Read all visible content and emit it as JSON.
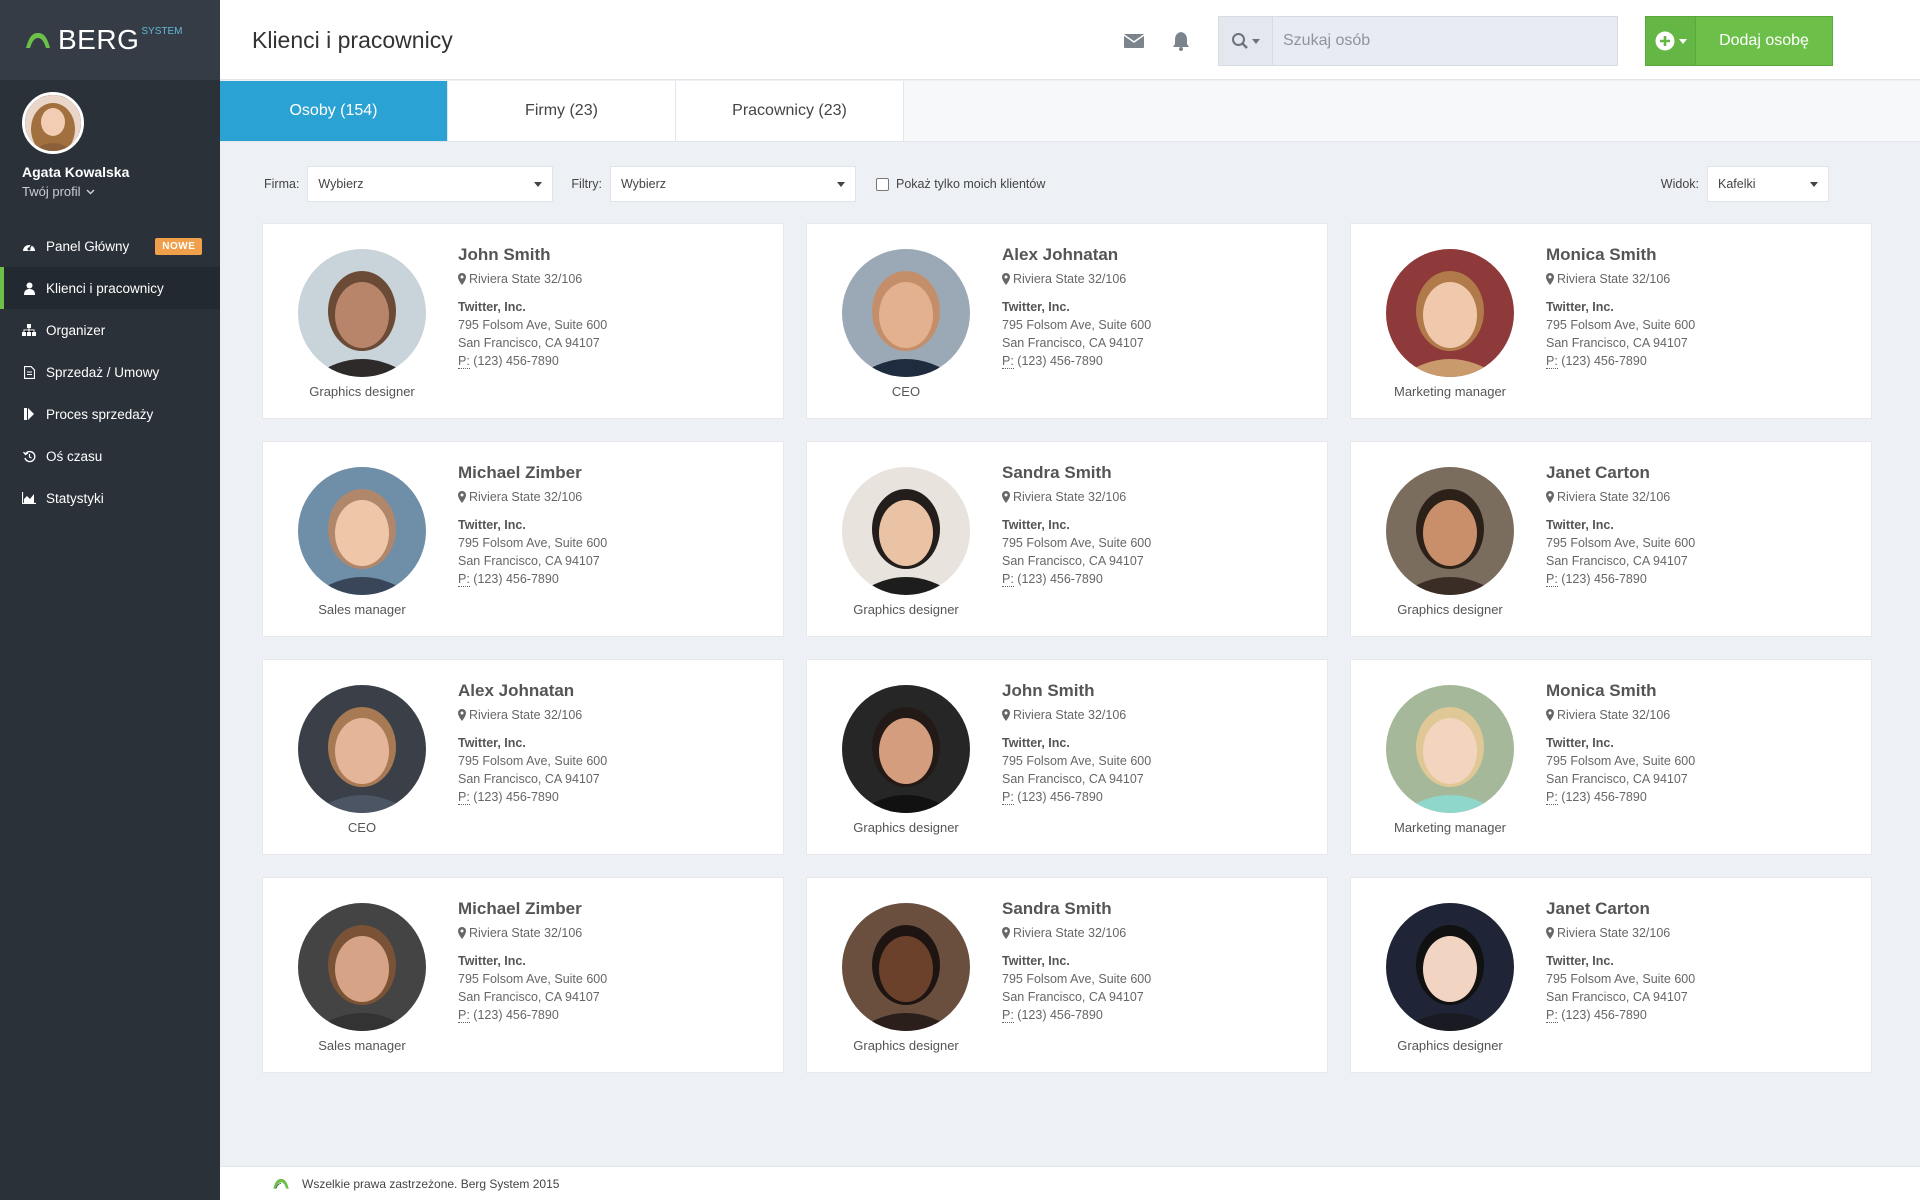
{
  "brand": {
    "name": "BERG",
    "sub": "SYSTEM",
    "accent": "#6cc04a",
    "blue": "#2aa3d4"
  },
  "user": {
    "name": "Agata Kowalska",
    "profile_link": "Twój profil"
  },
  "nav": [
    {
      "label": "Panel Główny",
      "icon": "dashboard-icon",
      "badge": "NOWE"
    },
    {
      "label": "Klienci i pracownicy",
      "icon": "user-icon",
      "active": true
    },
    {
      "label": "Organizer",
      "icon": "sitemap-icon"
    },
    {
      "label": "Sprzedaż / Umowy",
      "icon": "document-icon"
    },
    {
      "label": "Proces sprzedaży",
      "icon": "step-icon"
    },
    {
      "label": "Oś czasu",
      "icon": "history-icon"
    },
    {
      "label": "Statystyki",
      "icon": "area-chart-icon"
    }
  ],
  "header": {
    "title": "Klienci i pracownicy",
    "search_placeholder": "Szukaj osób",
    "add_label": "Dodaj osobę"
  },
  "tabs": [
    {
      "label": "Osoby (154)",
      "active": true
    },
    {
      "label": "Firmy (23)"
    },
    {
      "label": "Pracownicy (23)"
    }
  ],
  "filters": {
    "firma_label": "Firma:",
    "firma_value": "Wybierz",
    "filtry_label": "Filtry:",
    "filtry_value": "Wybierz",
    "checkbox_label": "Pokaż tylko moich klientów",
    "widok_label": "Widok:",
    "widok_value": "Kafelki"
  },
  "cards": [
    {
      "name": "John Smith",
      "address": "Riviera State 32/106",
      "company": "Twitter, Inc.",
      "street": "795 Folsom Ave, Suite 600",
      "city": "San Francisco, CA 94107",
      "phone_prefix": "P:",
      "phone": "(123) 456-7890",
      "role": "Graphics designer"
    },
    {
      "name": "Alex Johnatan",
      "address": "Riviera State 32/106",
      "company": "Twitter, Inc.",
      "street": "795 Folsom Ave, Suite 600",
      "city": "San Francisco, CA 94107",
      "phone_prefix": "P:",
      "phone": "(123) 456-7890",
      "role": "CEO"
    },
    {
      "name": "Monica Smith",
      "address": "Riviera State 32/106",
      "company": "Twitter, Inc.",
      "street": "795 Folsom Ave, Suite 600",
      "city": "San Francisco, CA 94107",
      "phone_prefix": "P:",
      "phone": "(123) 456-7890",
      "role": "Marketing manager"
    },
    {
      "name": "Michael Zimber",
      "address": "Riviera State 32/106",
      "company": "Twitter, Inc.",
      "street": "795 Folsom Ave, Suite 600",
      "city": "San Francisco, CA 94107",
      "phone_prefix": "P:",
      "phone": "(123) 456-7890",
      "role": "Sales manager"
    },
    {
      "name": "Sandra Smith",
      "address": "Riviera State 32/106",
      "company": "Twitter, Inc.",
      "street": "795 Folsom Ave, Suite 600",
      "city": "San Francisco, CA 94107",
      "phone_prefix": "P:",
      "phone": "(123) 456-7890",
      "role": "Graphics designer"
    },
    {
      "name": "Janet Carton",
      "address": "Riviera State 32/106",
      "company": "Twitter, Inc.",
      "street": "795 Folsom Ave, Suite 600",
      "city": "San Francisco, CA 94107",
      "phone_prefix": "P:",
      "phone": "(123) 456-7890",
      "role": "Graphics designer"
    },
    {
      "name": "Alex Johnatan",
      "address": "Riviera State 32/106",
      "company": "Twitter, Inc.",
      "street": "795 Folsom Ave, Suite 600",
      "city": "San Francisco, CA 94107",
      "phone_prefix": "P:",
      "phone": "(123) 456-7890",
      "role": "CEO"
    },
    {
      "name": "John Smith",
      "address": "Riviera State 32/106",
      "company": "Twitter, Inc.",
      "street": "795 Folsom Ave, Suite 600",
      "city": "San Francisco, CA 94107",
      "phone_prefix": "P:",
      "phone": "(123) 456-7890",
      "role": "Graphics designer"
    },
    {
      "name": "Monica Smith",
      "address": "Riviera State 32/106",
      "company": "Twitter, Inc.",
      "street": "795 Folsom Ave, Suite 600",
      "city": "San Francisco, CA 94107",
      "phone_prefix": "P:",
      "phone": "(123) 456-7890",
      "role": "Marketing manager"
    },
    {
      "name": "Michael Zimber",
      "address": "Riviera State 32/106",
      "company": "Twitter, Inc.",
      "street": "795 Folsom Ave, Suite 600",
      "city": "San Francisco, CA 94107",
      "phone_prefix": "P:",
      "phone": "(123) 456-7890",
      "role": "Sales manager"
    },
    {
      "name": "Sandra Smith",
      "address": "Riviera State 32/106",
      "company": "Twitter, Inc.",
      "street": "795 Folsom Ave, Suite 600",
      "city": "San Francisco, CA 94107",
      "phone_prefix": "P:",
      "phone": "(123) 456-7890",
      "role": "Graphics designer"
    },
    {
      "name": "Janet Carton",
      "address": "Riviera State 32/106",
      "company": "Twitter, Inc.",
      "street": "795 Folsom Ave, Suite 600",
      "city": "San Francisco, CA 94107",
      "phone_prefix": "P:",
      "phone": "(123) 456-7890",
      "role": "Graphics designer"
    }
  ],
  "footer": {
    "text": "Wszelkie prawa zastrzeżone. Berg System 2015"
  }
}
